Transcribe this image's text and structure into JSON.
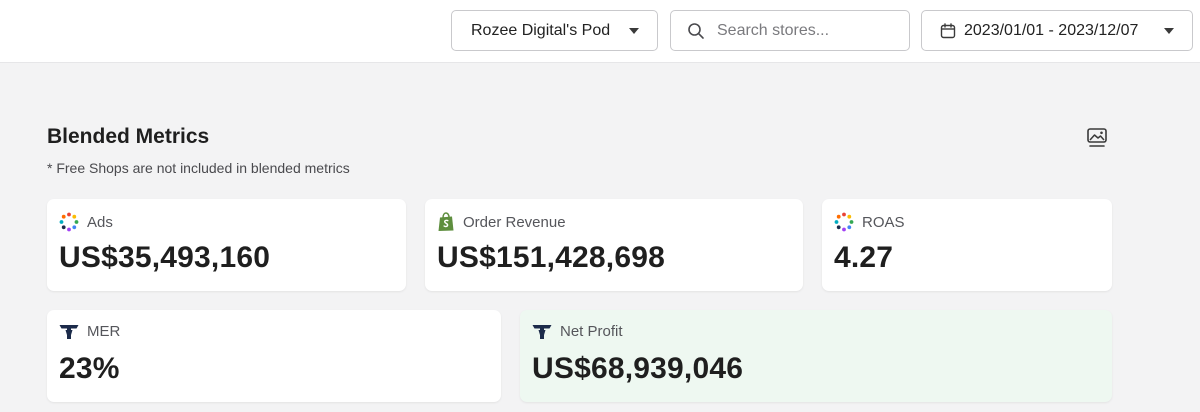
{
  "header": {
    "pod_selector": "Rozee Digital's Pod",
    "search_placeholder": "Search stores...",
    "date_range": "2023/01/01 - 2023/12/07"
  },
  "section": {
    "title": "Blended Metrics",
    "note": "* Free Shops are not included in blended metrics"
  },
  "metrics": [
    {
      "label": "Ads",
      "value": "US$35,493,160",
      "icon": "multicolor-dots-icon"
    },
    {
      "label": "Order Revenue",
      "value": "US$151,428,698",
      "icon": "shopify-bag-icon"
    },
    {
      "label": "ROAS",
      "value": "4.27",
      "icon": "multicolor-dots-icon"
    },
    {
      "label": "MER",
      "value": "23%",
      "icon": "brand-logo-icon"
    },
    {
      "label": "Net Profit",
      "value": "US$68,939,046",
      "icon": "brand-logo-icon"
    }
  ],
  "colors": {
    "page_background": "#f3f3f4",
    "net_profit_card": "#eef8f1",
    "shopify_green": "#5e8e3e",
    "brand_navy": "#1c2b4a"
  }
}
